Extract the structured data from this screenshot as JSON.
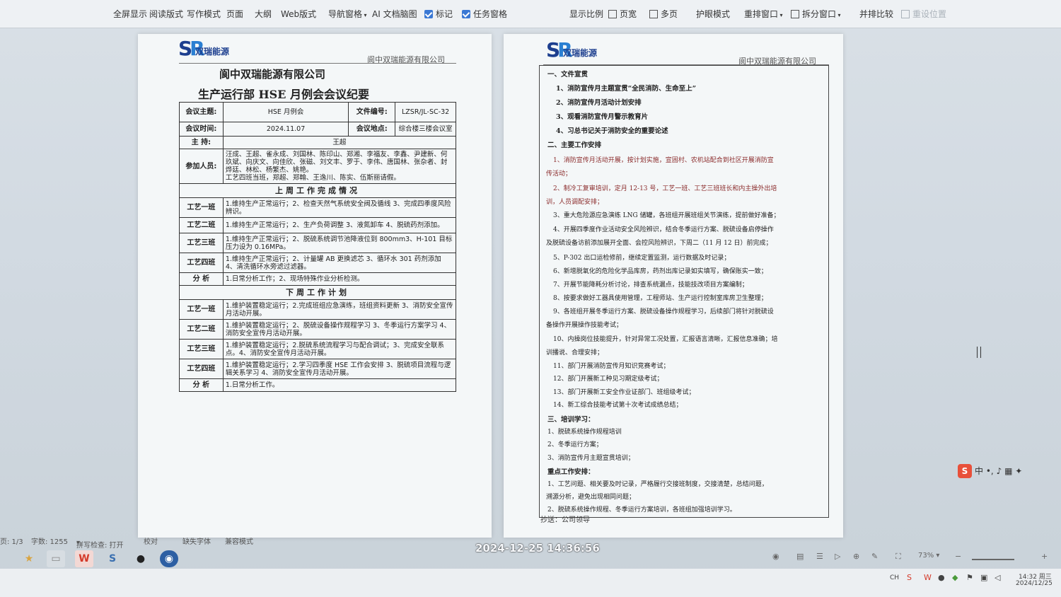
{
  "toolbar": {
    "items": [
      "全屏显示",
      "阅读版式",
      "写作模式",
      "页面",
      "大纲",
      "Web版式",
      "导航窗格",
      "AI 文档脑图",
      "标记",
      "任务窗格",
      "显示比例",
      "页宽",
      "多页",
      "护眼模式",
      "重排窗口",
      "拆分窗口",
      "并排比较",
      "重设位置"
    ]
  },
  "doc": {
    "company_header": "阆中双瑞能源有限公司",
    "logo_text": "双瑞能源",
    "title1": "阆中双瑞能源有限公司",
    "title2": "生产运行部 HSE 月例会会议纪要",
    "labels": {
      "topic": "会议主题:",
      "doc_no": "文件编号:",
      "time": "会议时间:",
      "place": "会议地点:",
      "host": "主  持:",
      "attendees": "参加人员:"
    },
    "values": {
      "topic": "HSE 月例会",
      "doc_no": "LZSR/JL-SC-32",
      "time": "2024.11.07",
      "place": "综合楼三楼会议室",
      "host": "王超",
      "attendees": "汪成、王超、雀永成、刘国林、陈印山、郑湘、李福友、李鑫、尹建新、何玖斌、向庆文、向佳欣、张磁、刘文丰、罗于、李伟、唐国林、张杂者、封烨廷、林松、杨繁杰、姚艳。\n工艺四班当班，郑超、郑翰、王逸川、陈实、伍斯丽请假。"
    },
    "last_week_title": "上周工作完成情况",
    "next_week_title": "下周工作计划",
    "last_week": [
      {
        "team": "工艺一班",
        "text": "1.维持生产正常运行；2、检查天然气系统安全阀及循线 3、完成四季度风险辨识。"
      },
      {
        "team": "工艺二班",
        "text": "1.维持生产正常运行；2、生产负荷调整 3、液氮卸车 4、脱硫药剂添加。"
      },
      {
        "team": "工艺三班",
        "text": "1.维持生产正常运行；2、脱硫系统调节池降液位到 800mm3、H-101 目标压力设为 0.16MPa。"
      },
      {
        "team": "工艺四班",
        "text": "1.维持生产正常运行；2、计量罐 AB 更换滤芯 3、循环水 301 药剂添加 4、清洗循环水旁滤过滤器。"
      },
      {
        "team": "分  析",
        "text": "1.日常分析工作；2、现场特殊作业分析检测。"
      }
    ],
    "next_week": [
      {
        "team": "工艺一班",
        "text": "1.维护装置稳定运行；2.完成班组应急演练，班组资料更新 3、消防安全宣传月活动开展。"
      },
      {
        "team": "工艺二班",
        "text": "1.维护装置稳定运行；2、脱硫设备操作规程学习 3、冬季运行方案学习 4、消防安全宣传月活动开展。"
      },
      {
        "team": "工艺三班",
        "text": "1.维护装置稳定运行；2.脱硫系统流程学习与配合调试；3、完成安全联系点。4、消防安全宣传月活动开展。"
      },
      {
        "team": "工艺四班",
        "text": "1.维护装置稳定运行；2.学习四季度 HSE 工作会安排 3、脱硫项目流程与逻辑关系学习 4、消防安全宣传月活动开展。"
      },
      {
        "team": "分  析",
        "text": "1.日常分析工作。"
      }
    ],
    "right_lines": [
      {
        "t": "一、文件宣贯",
        "h": true
      },
      {
        "t": "1、消防宣传月主题宣贯“全民消防、生命至上”",
        "h": true
      },
      {
        "t": "2、消防宣传月活动计划安排",
        "h": true
      },
      {
        "t": "3、观看消防宣传月警示教育片",
        "h": true
      },
      {
        "t": "4、习总书记关于消防安全的重要论述",
        "h": true
      },
      {
        "t": "二、主要工作安排",
        "h": true
      },
      {
        "t": "1、消防宣传月活动开展，按计划实施，宣固村、农机站配合到社区开展消防宣",
        "red": true
      },
      {
        "t": "传活动；",
        "red": true
      },
      {
        "t": "2、制冷工复审培训，定月 12-13 号，工艺一班、工艺三班班长和内主操外出培",
        "red": true
      },
      {
        "t": "训，人员调配安排；",
        "red": true
      },
      {
        "t": "3、重大危险源应急演练 LNG 储罐，各班组开展班组关节演练，提前做好准备；"
      },
      {
        "t": "4、开展四季度作业活动安全风险辨识，结合冬季运行方案、脱硫设备启停操作"
      },
      {
        "t": "及脱硫设备访前添加展开全面、会控风险辨识，下周二（11 月 12 日）前完成；"
      },
      {
        "t": "5、P-302 出口运检修前，继续定置监测，运行数据及时记录；"
      },
      {
        "t": "6、新增脱氧化的危险化学品库房，药剂出库记录如实填写，确保账实一致；"
      },
      {
        "t": "7、开展节能降耗分析讨论，排查系统漏点，技能技改项目方案编制；"
      },
      {
        "t": "8、按要求做好工器具使用管理，工程师站、生产运行控制室库房卫生整理；"
      },
      {
        "t": "9、各班组开展冬季运行方案、脱硫设备操作规程学习，后续部门将针对脱硫设"
      },
      {
        "t": "备操作开展操作技能考试；"
      },
      {
        "t": "10、内操岗位技能提升，针对异常工况处置，汇报语言清晰，汇报信息准确；培"
      },
      {
        "t": "训播说、合理安排；"
      },
      {
        "t": "11、部门开展消防宣传月知识竞赛考试；"
      },
      {
        "t": "12、部门开展新工种见习期定级考试；"
      },
      {
        "t": "13、部门开展新工安全作业证部门、班组级考试；"
      },
      {
        "t": "14、新工综合技能考试第十次考试成绩总结；"
      },
      {
        "t": "三、培训学习：",
        "h": true
      },
      {
        "t": "1、脱硫系统操作规程培训"
      },
      {
        "t": "2、冬季运行方案；"
      },
      {
        "t": "3、消防宣传月主题宣贯培训；"
      },
      {
        "t": "重点工作安排：",
        "h": true
      },
      {
        "t": "1、工艺问题、相关要及时记录，严格履行交接班制度，交接清楚，总结问题，"
      },
      {
        "t": "溯源分析，避免出现相同问题；"
      },
      {
        "t": "2、脱硫系统操作规程、冬季运行方案培训，各班组加强培训学习。"
      }
    ],
    "cc": "抄送：公司领导"
  },
  "status": {
    "page": "页: 1/3",
    "words": "字数: 1255",
    "spell": "拼写检查: 打开",
    "proof": "校对",
    "font_missing": "缺失字体",
    "compat": "兼容模式",
    "zoom": "73%"
  },
  "timestamp": "2024-12-25 14:36:56",
  "tray": {
    "lang": "CH",
    "clock": "14:32 周三",
    "date": "2024/12/25",
    "ime_text": "中"
  }
}
